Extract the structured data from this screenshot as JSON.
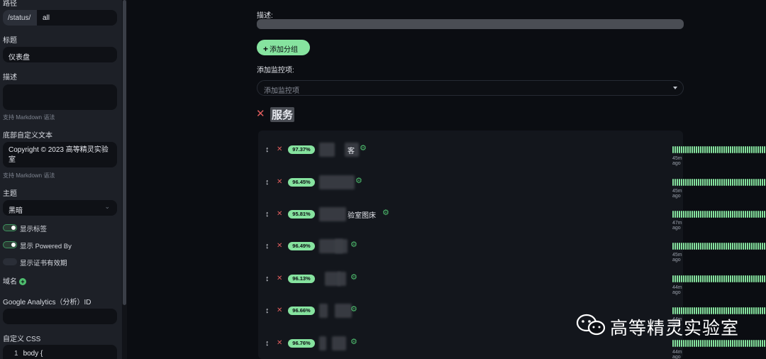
{
  "sidebar": {
    "path_label": "路径",
    "path_prefix": "/status/",
    "path_value": "all",
    "title_label": "标题",
    "title_value": "仪表盘",
    "desc_label": "描述",
    "desc_hint": "支持 Markdown 语法",
    "footer_label": "底部自定义文本",
    "footer_line1": "Copyright © 2023 高等精灵实验",
    "footer_line2": "室",
    "footer_hint": "支持 Markdown 语法",
    "theme_label": "主题",
    "theme_value": "黑暗",
    "toggles": [
      {
        "label": "显示标签",
        "on": true
      },
      {
        "label": "显示 Powered By",
        "on": true
      },
      {
        "label": "显示证书有效期",
        "on": false
      }
    ],
    "domain_label": "域名",
    "ga_label": "Google Analytics（分析）ID",
    "css_label": "自定义 CSS",
    "css_line_number": "1",
    "css_code": "body {"
  },
  "main": {
    "desc_label": "描述:",
    "add_group_label": "添加分组",
    "add_monitor_label": "添加监控项:",
    "add_monitor_placeholder": "添加监控项",
    "group_title": "服务",
    "monitors": [
      {
        "pct": "97.37%",
        "name": "客",
        "ago": "45m ago",
        "now": "now"
      },
      {
        "pct": "96.45%",
        "name": "",
        "ago": "45m ago",
        "now": "now"
      },
      {
        "pct": "95.81%",
        "name": "验室图床",
        "ago": "47m ago",
        "now": "now"
      },
      {
        "pct": "96.49%",
        "name": "",
        "ago": "45m ago",
        "now": "now"
      },
      {
        "pct": "96.13%",
        "name": "",
        "ago": "44m ago",
        "now": "now"
      },
      {
        "pct": "96.66%",
        "name": "",
        "ago": "44m ago",
        "now": "now"
      },
      {
        "pct": "96.76%",
        "name": "",
        "ago": "44m ago",
        "now": "now"
      }
    ]
  },
  "watermark": {
    "text": "高等精灵实验室"
  },
  "colors": {
    "accent": "#86e39f",
    "danger": "#e15d5d",
    "bg": "#0b0d12",
    "sidebar": "#1d2027"
  }
}
